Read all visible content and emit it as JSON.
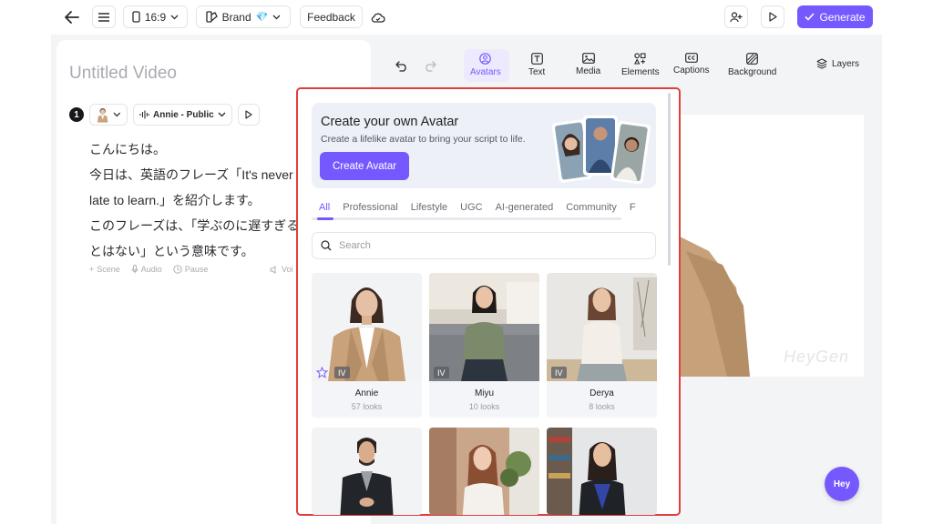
{
  "topbar": {
    "aspect_ratio": "16:9",
    "brand_label": "Brand",
    "brand_emoji": "💎",
    "feedback_label": "Feedback",
    "generate_label": "Generate"
  },
  "script": {
    "video_title": "Untitled Video",
    "scene_number": "1",
    "voice_label": "Annie - Public",
    "lines": [
      "こんにちは。",
      "今日は、英語のフレーズ「It's never too",
      "late to learn.」を紹介します。",
      "このフレーズは、「学ぶのに遅すぎるこ",
      "とはない」という意味です。"
    ],
    "actions": {
      "scene": "Scene",
      "audio": "Audio",
      "pause": "Pause",
      "voice": "Voi"
    }
  },
  "tools": [
    {
      "label": "Avatars",
      "icon": "avatar-icon"
    },
    {
      "label": "Text",
      "icon": "text-icon"
    },
    {
      "label": "Media",
      "icon": "media-icon"
    },
    {
      "label": "Elements",
      "icon": "elements-icon"
    },
    {
      "label": "Captions",
      "icon": "captions-icon"
    },
    {
      "label": "Background",
      "icon": "background-icon"
    }
  ],
  "layers_label": "Layers",
  "popup": {
    "promo_title": "Create your own Avatar",
    "promo_subtitle": "Create a lifelike avatar to bring your script to life.",
    "promo_button": "Create Avatar",
    "categories": [
      "All",
      "Professional",
      "Lifestyle",
      "UGC",
      "AI-generated",
      "Community",
      "F"
    ],
    "active_category": "All",
    "search_placeholder": "Search",
    "avatars": [
      {
        "name": "Annie",
        "looks": "57 looks",
        "badge": "IV"
      },
      {
        "name": "Miyu",
        "looks": "10 looks",
        "badge": "IV"
      },
      {
        "name": "Derya",
        "looks": "8 looks",
        "badge": "IV"
      },
      {
        "name": "",
        "looks": "",
        "badge": ""
      },
      {
        "name": "",
        "looks": "",
        "badge": ""
      },
      {
        "name": "",
        "looks": "",
        "badge": ""
      }
    ]
  },
  "preview": {
    "watermark": "HeyGen"
  },
  "chat_button": "Hey",
  "colors": {
    "accent": "#7559ff",
    "highlight_border": "#e03e3e"
  }
}
